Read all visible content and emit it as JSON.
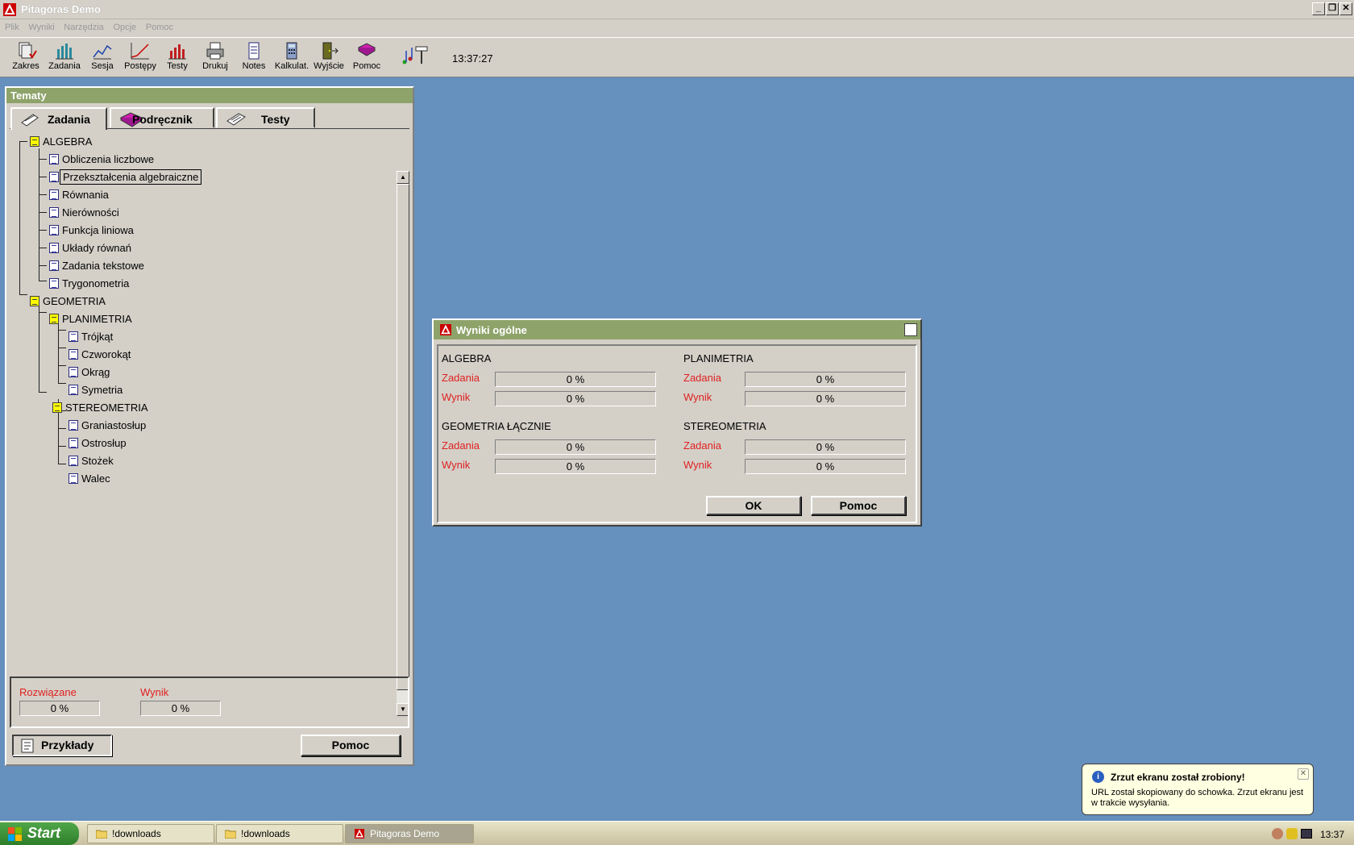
{
  "window": {
    "title": "Pitagoras Demo"
  },
  "menu": [
    "Plik",
    "Wyniki",
    "Narzędzia",
    "Opcje",
    "Pomoc"
  ],
  "toolbar": {
    "buttons": [
      "Zakres",
      "Zadania",
      "Sesja",
      "Postępy",
      "Testy",
      "Drukuj",
      "Notes",
      "Kalkulat.",
      "Wyjście",
      "Pomoc"
    ],
    "clock": "13:37:27"
  },
  "panel": {
    "title": "Tematy",
    "tabs": [
      "Zadania",
      "Podręcznik",
      "Testy"
    ],
    "tree": {
      "algebra": "ALGEBRA",
      "algebra_items": [
        "Obliczenia liczbowe",
        "Przekształcenia algebraiczne",
        "Równania",
        "Nierówności",
        "Funkcja liniowa",
        "Układy równań",
        "Zadania tekstowe",
        "Trygonometria"
      ],
      "geometria": "GEOMETRIA",
      "planimetria": "PLANIMETRIA",
      "planimetria_items": [
        "Trójkąt",
        "Czworokąt",
        "Okrąg",
        "Symetria"
      ],
      "stereometria": "STEREOMETRIA",
      "stereometria_items": [
        "Graniastosłup",
        "Ostrosłup",
        "Stożek",
        "Walec"
      ]
    },
    "selected_item": "Przekształcenia algebraiczne",
    "stats": {
      "solved_label": "Rozwiązane",
      "solved_value": "0 %",
      "score_label": "Wynik",
      "score_value": "0 %"
    },
    "examples_button": "Przykłady",
    "help_button": "Pomoc"
  },
  "dialog": {
    "title": "Wyniki ogólne",
    "groups": [
      {
        "name": "ALGEBRA",
        "zadania_label": "Zadania",
        "zadania": "0 %",
        "wynik_label": "Wynik",
        "wynik": "0 %"
      },
      {
        "name": "PLANIMETRIA",
        "zadania_label": "Zadania",
        "zadania": "0 %",
        "wynik_label": "Wynik",
        "wynik": "0 %"
      },
      {
        "name": "GEOMETRIA ŁĄCZNIE",
        "zadania_label": "Zadania",
        "zadania": "0 %",
        "wynik_label": "Wynik",
        "wynik": "0 %"
      },
      {
        "name": "STEREOMETRIA",
        "zadania_label": "Zadania",
        "zadania": "0 %",
        "wynik_label": "Wynik",
        "wynik": "0 %"
      }
    ],
    "ok_button": "OK",
    "help_button": "Pomoc"
  },
  "taskbar": {
    "start": "Start",
    "tasks": [
      "!downloads",
      "!downloads",
      "Pitagoras Demo"
    ],
    "time": "13:37"
  },
  "balloon": {
    "title": "Zrzut ekranu został zrobiony!",
    "body": "URL został skopiowany do schowka. Zrzut ekranu jest w trakcie wysyłania."
  },
  "colors": {
    "accent_green": "#8ea36a",
    "desktop": "#6690bd",
    "red_label": "#e02020"
  }
}
